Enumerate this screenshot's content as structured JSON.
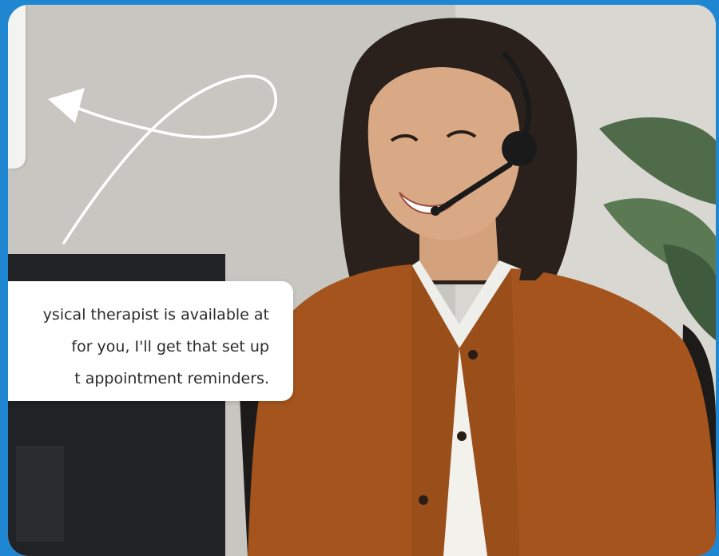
{
  "chat_bubble": {
    "lines": [
      "ysical therapist is available at",
      "for you, I'll get that set up",
      "t appointment reminders."
    ]
  },
  "colors": {
    "frame": "#1f86d2",
    "bubble": "#ffffff",
    "cardigan": "#a4541c",
    "hair": "#2a211d"
  },
  "icons": {
    "arrow": "hand-drawn-loop-arrow-icon",
    "headset": "headset-icon"
  }
}
